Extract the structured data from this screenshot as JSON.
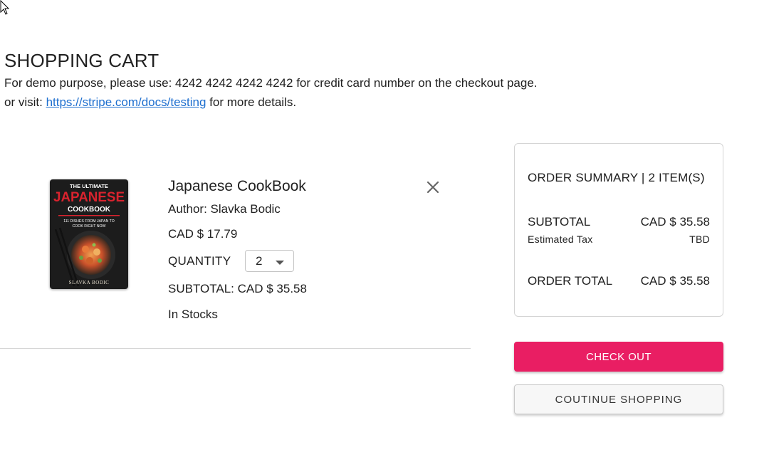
{
  "header": {
    "title": "SHOPPING CART",
    "note_line1": "For demo purpose, please use: 4242 4242 4242 4242 for credit card number on the checkout page.",
    "note_prefix": "or visit: ",
    "note_link": "https://stripe.com/docs/testing",
    "note_suffix": " for more details."
  },
  "item": {
    "name": "Japanese CookBook",
    "author": "Author: Slavka Bodic",
    "price": "CAD $ 17.79",
    "quantity_label": "QUANTITY",
    "quantity": "2",
    "subtotal": "SUBTOTAL: CAD $ 35.58",
    "stock": "In Stocks",
    "cover": {
      "line1": "THE ULTIMATE",
      "line2": "JAPANESE",
      "line3": "COOKBOOK",
      "line4": "111 DISHES FROM JAPAN TO",
      "line5": "COOK RIGHT NOW",
      "author": "SLAVKA BODIC"
    }
  },
  "summary": {
    "title": "ORDER SUMMARY | 2 ITEM(S)",
    "subtotal_label": "SUBTOTAL",
    "subtotal_value": "CAD $ 35.58",
    "tax_label": "Estimated Tax",
    "tax_value": "TBD",
    "total_label": "ORDER TOTAL",
    "total_value": "CAD $ 35.58"
  },
  "buttons": {
    "checkout": "CHECK OUT",
    "continue": "COUTINUE SHOPPING"
  },
  "colors": {
    "accent": "#e91e63",
    "link": "#1e6fcf"
  }
}
